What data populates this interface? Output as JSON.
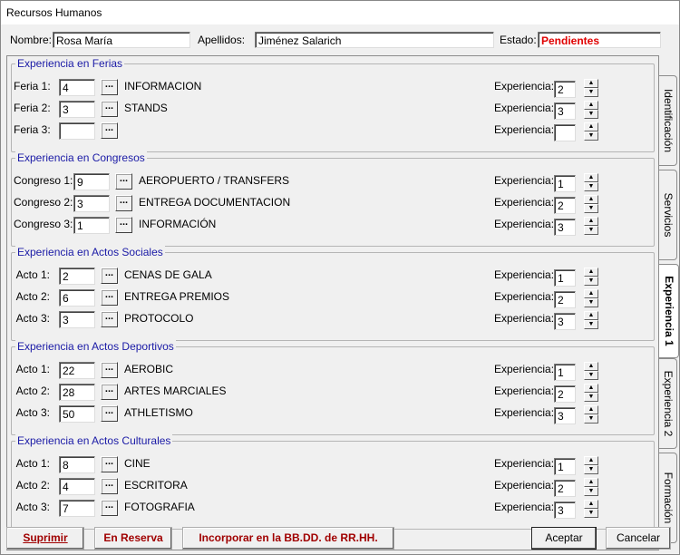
{
  "window": {
    "title": "Recursos Humanos"
  },
  "header": {
    "nombre_label": "Nombre:",
    "nombre_value": "Rosa María",
    "apellidos_label": "Apellidos:",
    "apellidos_value": "Jiménez Salarich",
    "estado_label": "Estado:",
    "estado_value": "Pendientes"
  },
  "exp_label": "Experiencia:",
  "dots_label": "...",
  "groups": [
    {
      "title": "Experiencia en Ferias",
      "rows": [
        {
          "label": "Feria 1:",
          "value": "4",
          "desc": "INFORMACION",
          "exp": "2"
        },
        {
          "label": "Feria 2:",
          "value": "3",
          "desc": "STANDS",
          "exp": "3"
        },
        {
          "label": "Feria 3:",
          "value": "",
          "desc": "",
          "exp": ""
        }
      ]
    },
    {
      "title": "Experiencia en Congresos",
      "rows": [
        {
          "label": "Congreso 1:",
          "value": "9",
          "desc": "AEROPUERTO / TRANSFERS",
          "exp": "1"
        },
        {
          "label": "Congreso 2:",
          "value": "3",
          "desc": "ENTREGA DOCUMENTACION",
          "exp": "2"
        },
        {
          "label": "Congreso 3:",
          "value": "1",
          "desc": "INFORMACIÓN",
          "exp": "3"
        }
      ]
    },
    {
      "title": "Experiencia en Actos Sociales",
      "rows": [
        {
          "label": "Acto 1:",
          "value": "2",
          "desc": "CENAS DE GALA",
          "exp": "1"
        },
        {
          "label": "Acto 2:",
          "value": "6",
          "desc": "ENTREGA PREMIOS",
          "exp": "2"
        },
        {
          "label": "Acto 3:",
          "value": "3",
          "desc": "PROTOCOLO",
          "exp": "3"
        }
      ]
    },
    {
      "title": "Experiencia en Actos Deportivos",
      "rows": [
        {
          "label": "Acto 1:",
          "value": "22",
          "desc": "AEROBIC",
          "exp": "1"
        },
        {
          "label": "Acto 2:",
          "value": "28",
          "desc": "ARTES MARCIALES",
          "exp": "2"
        },
        {
          "label": "Acto 3:",
          "value": "50",
          "desc": "ATHLETISMO",
          "exp": "3"
        }
      ]
    },
    {
      "title": "Experiencia en Actos Culturales",
      "rows": [
        {
          "label": "Acto 1:",
          "value": "8",
          "desc": "CINE",
          "exp": "1"
        },
        {
          "label": "Acto 2:",
          "value": "4",
          "desc": "ESCRITORA",
          "exp": "2"
        },
        {
          "label": "Acto 3:",
          "value": "7",
          "desc": "FOTOGRAFIA",
          "exp": "3"
        }
      ]
    }
  ],
  "tabs": [
    {
      "label": "Identificación",
      "active": false
    },
    {
      "label": "Servicios",
      "active": false
    },
    {
      "label": "Experiencia 1",
      "active": true
    },
    {
      "label": "Experiencia 2",
      "active": false
    },
    {
      "label": "Formación",
      "active": false
    }
  ],
  "buttons": {
    "suprimir": "Suprimir",
    "reserva": "En Reserva",
    "incorporar": "Incorporar en la BB.DD. de RR.HH.",
    "aceptar": "Aceptar",
    "cancelar": "Cancelar"
  },
  "colors": {
    "estado": "#e00000",
    "group_title": "#1a1aa6",
    "action_buttons": "#a00000"
  }
}
